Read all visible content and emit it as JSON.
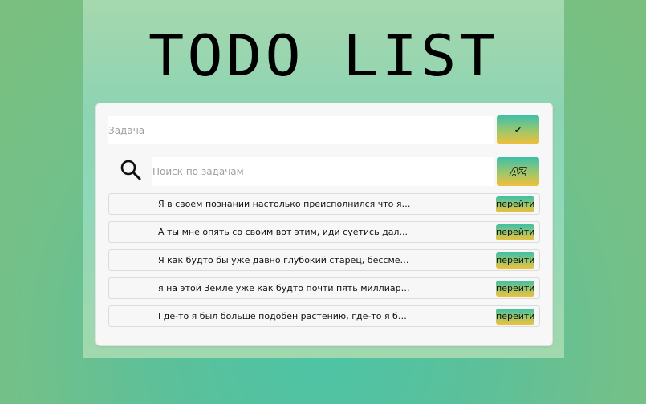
{
  "app": {
    "title": "TODO LIST"
  },
  "task_input": {
    "value": "",
    "placeholder": "Задача"
  },
  "add_button": {
    "label": "✔",
    "icon": "check-icon"
  },
  "search": {
    "icon": "search-icon",
    "value": "",
    "placeholder": "Поиск по задачам"
  },
  "sort_button": {
    "label": "AZ",
    "icon": "sort-az-icon"
  },
  "tasks": [
    {
      "text": "Я в своем познании настолько преисполнился что я к...",
      "action": "перейти"
    },
    {
      "text": "А ты мне опять со своим вот этим, иди суетись дал...",
      "action": "перейти"
    },
    {
      "text": "Я как будто бы уже давно глубокий старец, бессмерт...",
      "action": "перейти"
    },
    {
      "text": "я на этой Земле уже как будто почти пять миллиардо...",
      "action": "перейти"
    },
    {
      "text": "Где-то я был больше подобен растению, где-то я бол...",
      "action": "перейти"
    }
  ],
  "colors": {
    "background": "#6fc08a",
    "panel": "#94d6b3",
    "card": "#f7f7f7",
    "button_gradient_top": "#3fbfa8",
    "button_gradient_bottom": "#f0bf3a"
  }
}
